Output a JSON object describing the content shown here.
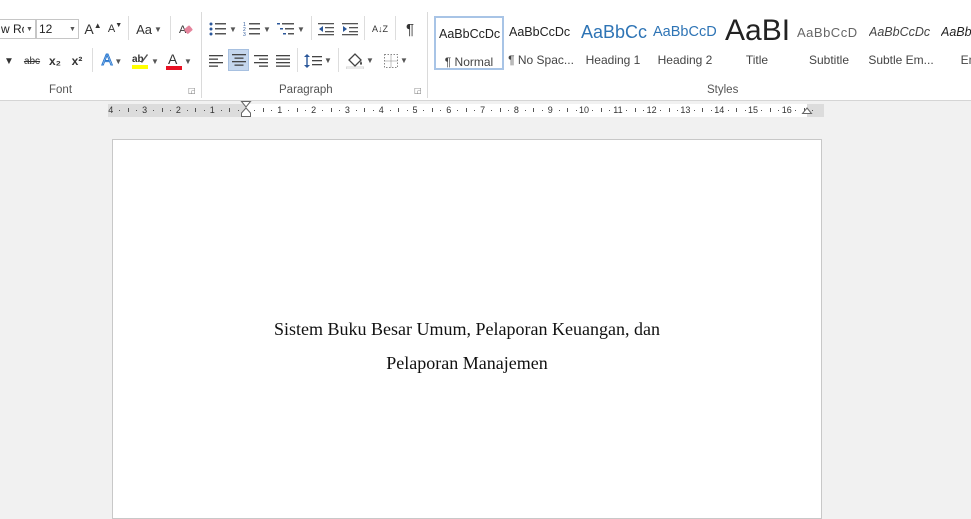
{
  "font_group": {
    "label": "Font",
    "font_name": "w Ro",
    "font_size": "12",
    "grow_label": "A",
    "shrink_label": "A",
    "change_case_label": "Aa",
    "strike_label": "abc",
    "subscript_label": "x₂",
    "superscript_label": "x²",
    "text_effects_label": "A",
    "font_color_label": "A",
    "highlight_color": "#ffff00",
    "font_color": "#e81123"
  },
  "paragraph_group": {
    "label": "Paragraph",
    "sort_label": "A↓Z",
    "pilcrow": "¶"
  },
  "styles_group": {
    "label": "Styles",
    "items": [
      {
        "preview": "AaBbCcDc",
        "name": "¶ Normal",
        "active": true
      },
      {
        "preview": "AaBbCcDc",
        "name": "¶ No Spac..."
      },
      {
        "preview": "AaBbCc",
        "name": "Heading 1"
      },
      {
        "preview": "AaBbCcD",
        "name": "Heading 2"
      },
      {
        "preview": "AaBI",
        "name": "Title"
      },
      {
        "preview": "AaBbCcD",
        "name": "Subtitle"
      },
      {
        "preview": "AaBbCcDc",
        "name": "Subtle Em..."
      },
      {
        "preview": "AaBb",
        "name": "Emp"
      }
    ],
    "heading_color": "#2e74b5"
  },
  "ruler": {
    "left_numbers": [
      "4",
      "3",
      "2",
      "1"
    ],
    "right_numbers": [
      "1",
      "2",
      "3",
      "4",
      "5",
      "6",
      "7",
      "8",
      "9",
      "10",
      "11",
      "12",
      "13",
      "14",
      "15",
      "16"
    ]
  },
  "document": {
    "line1": "Sistem Buku Besar Umum, Pelaporan Keuangan, dan",
    "line2": "Pelaporan Manajemen"
  }
}
